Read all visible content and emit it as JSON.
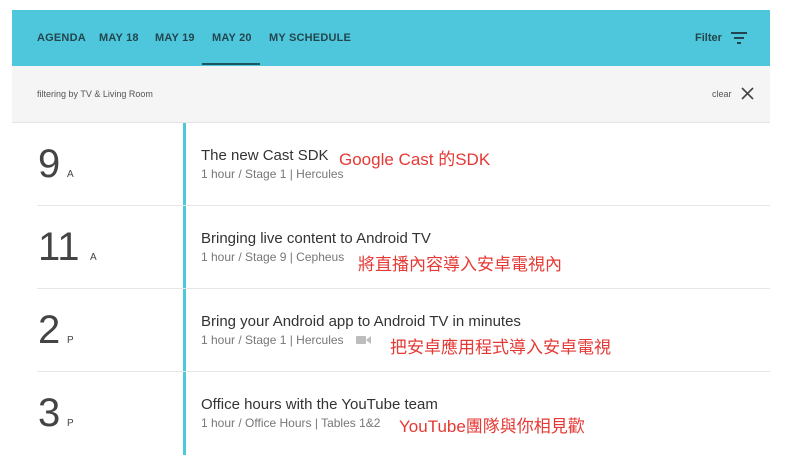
{
  "appbar": {
    "tabs": [
      "AGENDA",
      "MAY 18",
      "MAY 19",
      "MAY 20",
      "MY SCHEDULE"
    ],
    "active_tab": "MAY 20",
    "filter_label": "Filter",
    "filter_icon": "filter-list-icon",
    "background_color": "#4ec7dc"
  },
  "filter_bar": {
    "text": "filtering by TV & Living Room",
    "clear_label": "clear",
    "clear_icon": "close-icon"
  },
  "sessions": [
    {
      "hour": "9",
      "period": "A",
      "title": "The new Cast SDK",
      "meta": "1 hour / Stage 1 | Hercules",
      "annotation": "Google Cast 的SDK"
    },
    {
      "hour": "11",
      "period": "A",
      "title": "Bringing live content to Android TV",
      "meta": "1 hour / Stage 9 | Cepheus",
      "annotation": "將直播內容導入安卓電視內"
    },
    {
      "hour": "2",
      "period": "P",
      "title": "Bring your Android app to Android TV in minutes",
      "meta": "1 hour / Stage 1 | Hercules",
      "meta_icon": "video-camera-icon",
      "annotation": "把安卓應用程式導入安卓電視"
    },
    {
      "hour": "3",
      "period": "P",
      "title": "Office hours with the YouTube team",
      "meta": "1 hour / Office Hours | Tables 1&2",
      "annotation": "YouTube團隊與你相見歡"
    }
  ],
  "colors": {
    "accent": "#4ec7dc",
    "annotation": "#e53935"
  }
}
